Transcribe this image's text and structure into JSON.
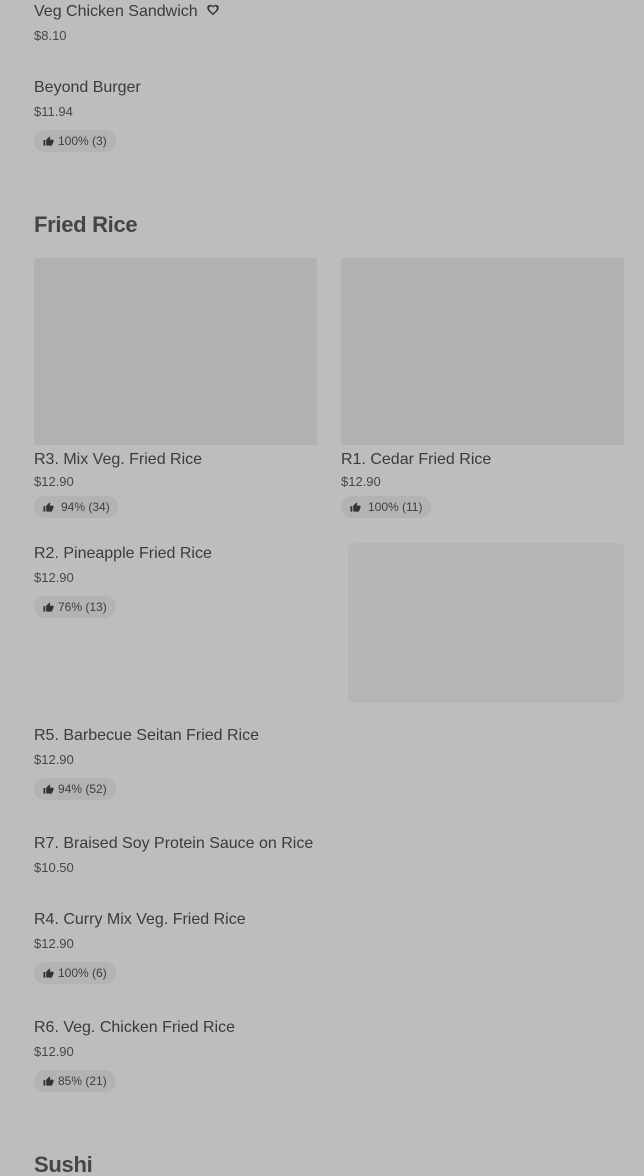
{
  "top_items": [
    {
      "name": "Veg Chicken Sandwich",
      "price": "$8.10",
      "heart_icon": "heart-icon"
    },
    {
      "name": "Beyond Burger",
      "price": "$11.94",
      "rating": "100% (3)"
    }
  ],
  "sections": {
    "fried_rice": {
      "title": "Fried Rice",
      "cards": [
        {
          "name": "R3. Mix Veg. Fried Rice",
          "price": "$12.90",
          "rating": "94% (34)"
        },
        {
          "name": "R1. Cedar Fried Rice",
          "price": "$12.90",
          "rating": "100% (11)"
        }
      ],
      "feature": {
        "name": "R2. Pineapple Fried Rice",
        "price": "$12.90",
        "rating": "76% (13)"
      },
      "list": [
        {
          "name": "R5. Barbecue Seitan Fried Rice",
          "price": "$12.90",
          "rating": "94% (52)"
        },
        {
          "name": "R7. Braised Soy Protein Sauce on Rice",
          "price": "$10.50"
        },
        {
          "name": "R4. Curry Mix Veg. Fried Rice",
          "price": "$12.90",
          "rating": "100% (6)"
        },
        {
          "name": "R6. Veg. Chicken Fried Rice",
          "price": "$12.90",
          "rating": "85% (21)"
        }
      ]
    },
    "sushi": {
      "title": "Sushi"
    }
  },
  "icons": {
    "rating": "thumbs-up-icon"
  }
}
